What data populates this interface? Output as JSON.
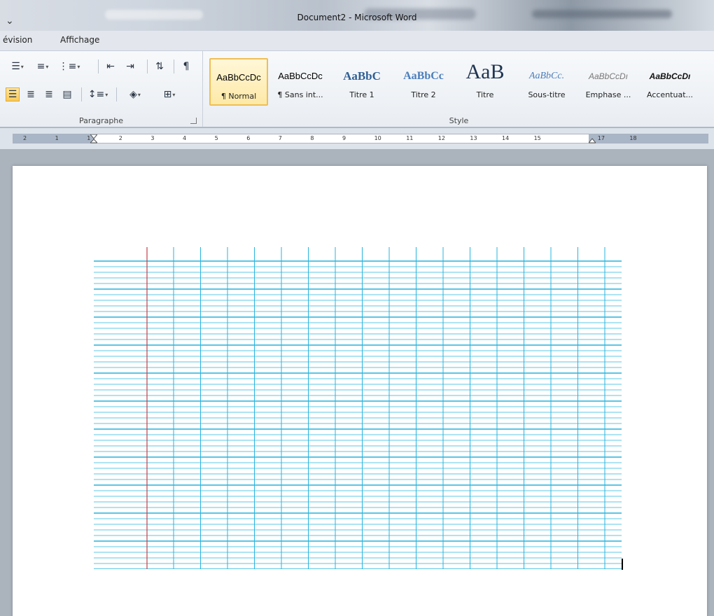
{
  "window": {
    "title": "Document2 - Microsoft Word"
  },
  "tabs": [
    {
      "label": "évision"
    },
    {
      "label": "Affichage"
    }
  ],
  "ribbon": {
    "paragraph_group": {
      "label": "Paragraphe",
      "icons": [
        "bullets-icon",
        "numbering-icon",
        "multilevel-list-icon",
        "decrease-indent-icon",
        "increase-indent-icon",
        "sort-icon",
        "pilcrow-icon",
        "align-left-icon",
        "align-center-icon",
        "align-right-icon",
        "justify-icon",
        "line-spacing-icon",
        "shading-icon",
        "borders-icon"
      ]
    },
    "style_group": {
      "label": "Style",
      "styles": [
        {
          "sample": "AaBbCcDc",
          "name": "¶ Normal",
          "selected": true
        },
        {
          "sample": "AaBbCcDc",
          "name": "¶ Sans int...",
          "selected": false
        },
        {
          "sample": "AaBbC",
          "name": "Titre 1",
          "selected": false
        },
        {
          "sample": "AaBbCc",
          "name": "Titre 2",
          "selected": false
        },
        {
          "sample": "AaB",
          "name": "Titre",
          "selected": false
        },
        {
          "sample": "AaBbCc.",
          "name": "Sous-titre",
          "selected": false
        },
        {
          "sample": "AaBbCcDı",
          "name": "Emphase ...",
          "selected": false
        },
        {
          "sample": "AaBbCcDı",
          "name": "Accentuat...",
          "selected": false
        }
      ]
    }
  },
  "ruler": {
    "ticks": [
      "2",
      "1",
      "1",
      "2",
      "3",
      "4",
      "5",
      "6",
      "7",
      "8",
      "9",
      "10",
      "11",
      "12",
      "13",
      "14",
      "15",
      "17",
      "18"
    ]
  },
  "colors": {
    "grid_line": "#27b4dc",
    "margin_line": "#c0404a"
  }
}
